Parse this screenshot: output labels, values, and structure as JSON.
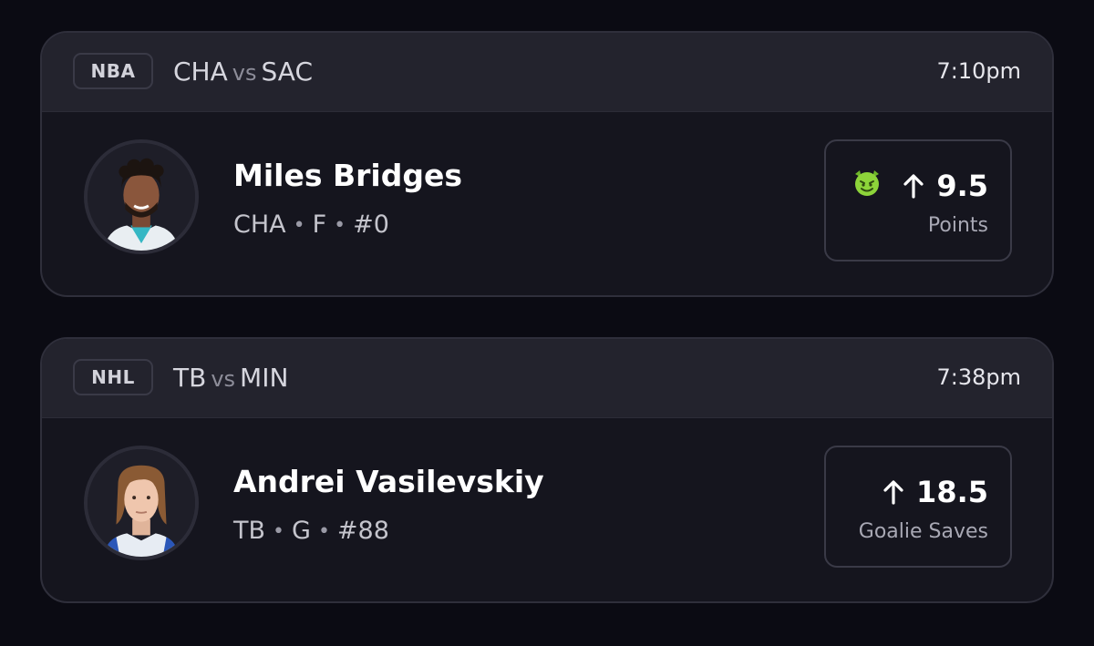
{
  "games": [
    {
      "league": "NBA",
      "home": "CHA",
      "vs": "vs",
      "away": "SAC",
      "time": "7:10pm",
      "player": {
        "name": "Miles Bridges",
        "team": "CHA",
        "position": "F",
        "number": "#0",
        "avatar_icon": "player-headshot-icon"
      },
      "prop": {
        "direction": "up-arrow-icon",
        "line": "9.5",
        "stat": "Points",
        "badge_icon": "devil-emoji-icon",
        "badge_color": "#8dd43a"
      }
    },
    {
      "league": "NHL",
      "home": "TB",
      "vs": "vs",
      "away": "MIN",
      "time": "7:38pm",
      "player": {
        "name": "Andrei Vasilevskiy",
        "team": "TB",
        "position": "G",
        "number": "#88",
        "avatar_icon": "player-headshot-icon"
      },
      "prop": {
        "direction": "up-arrow-icon",
        "line": "18.5",
        "stat": "Goalie Saves"
      }
    }
  ],
  "separator": "•",
  "colors": {
    "background": "#0b0b13",
    "card": "#15151e",
    "card_header": "#23232d",
    "border": "#3a3a47"
  }
}
